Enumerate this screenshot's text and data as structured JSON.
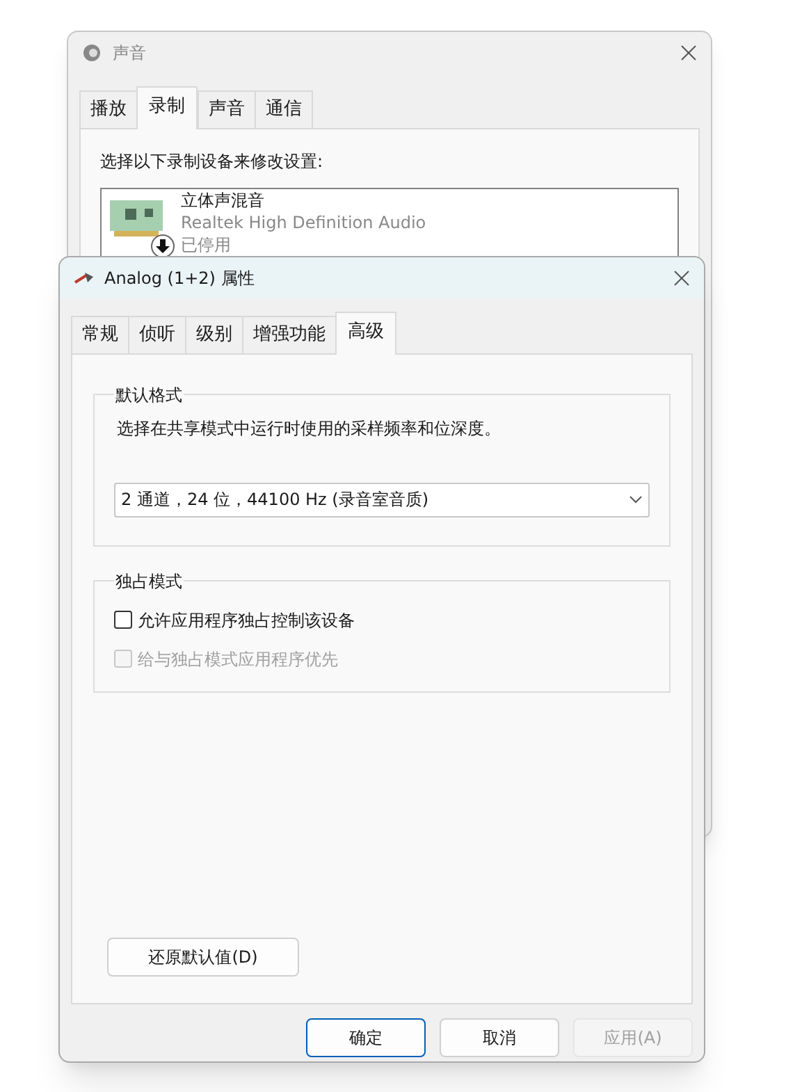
{
  "back_window": {
    "title": "声音",
    "tabs": [
      {
        "label": "播放",
        "selected": false
      },
      {
        "label": "录制",
        "selected": true
      },
      {
        "label": "声音",
        "selected": false
      },
      {
        "label": "通信",
        "selected": false
      }
    ],
    "instruction": "选择以下录制设备来修改设置:",
    "devices": [
      {
        "name": "立体声混音",
        "driver": "Realtek High Definition Audio",
        "status": "已停用",
        "disabled": true
      }
    ]
  },
  "dialog": {
    "title": "Analog (1+2) 属性",
    "tabs": [
      {
        "label": "常规",
        "selected": false
      },
      {
        "label": "侦听",
        "selected": false
      },
      {
        "label": "级别",
        "selected": false
      },
      {
        "label": "增强功能",
        "selected": false
      },
      {
        "label": "高级",
        "selected": true
      }
    ],
    "default_format": {
      "legend": "默认格式",
      "description": "选择在共享模式中运行时使用的采样频率和位深度。",
      "value": "2 通道，24 位，44100 Hz (录音室音质)"
    },
    "exclusive_mode": {
      "legend": "独占模式",
      "options": [
        {
          "label": "允许应用程序独占控制该设备",
          "checked": false,
          "disabled": false
        },
        {
          "label": "给与独占模式应用程序优先",
          "checked": false,
          "disabled": true
        }
      ]
    },
    "restore_button": "还原默认值(D)",
    "buttons": [
      {
        "label": "确定",
        "kind": "default",
        "disabled": false
      },
      {
        "label": "取消",
        "kind": "normal",
        "disabled": false
      },
      {
        "label": "应用(A)",
        "kind": "normal",
        "disabled": true
      }
    ]
  }
}
